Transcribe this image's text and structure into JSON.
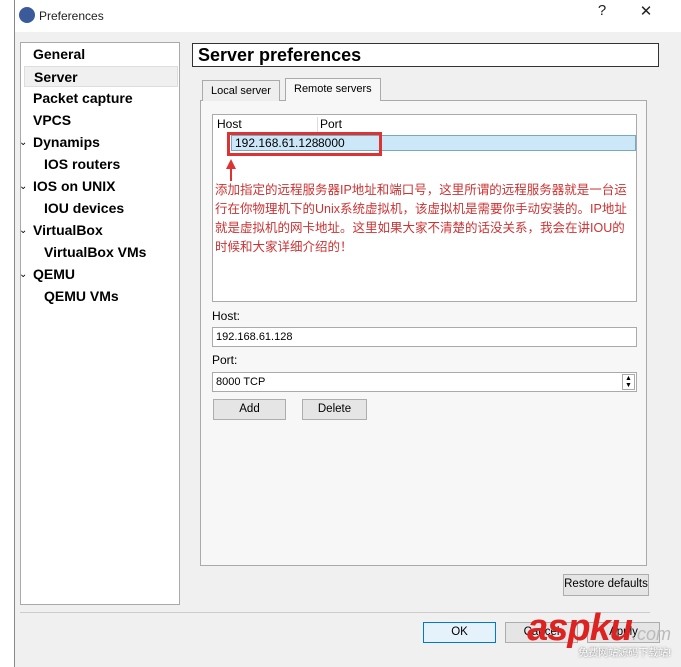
{
  "window": {
    "title": "Preferences",
    "help": "?",
    "close": "✕"
  },
  "sidebar": {
    "items": [
      {
        "label": "General",
        "level": 0
      },
      {
        "label": "Server",
        "level": 0,
        "selected": true
      },
      {
        "label": "Packet capture",
        "level": 0
      },
      {
        "label": "VPCS",
        "level": 0
      },
      {
        "label": "Dynamips",
        "level": 0,
        "expanded": true
      },
      {
        "label": "IOS routers",
        "level": 1
      },
      {
        "label": "IOS on UNIX",
        "level": 0,
        "expanded": true
      },
      {
        "label": "IOU devices",
        "level": 1
      },
      {
        "label": "VirtualBox",
        "level": 0,
        "expanded": true
      },
      {
        "label": "VirtualBox VMs",
        "level": 1
      },
      {
        "label": "QEMU",
        "level": 0,
        "expanded": true
      },
      {
        "label": "QEMU VMs",
        "level": 1
      }
    ]
  },
  "header": {
    "title": "Server preferences"
  },
  "tabs": [
    {
      "label": "Local server"
    },
    {
      "label": "Remote servers",
      "active": true
    }
  ],
  "servers": {
    "columns": [
      "Host",
      "Port"
    ],
    "rows": [
      {
        "host": "192.168.61.128",
        "port": "8000"
      }
    ]
  },
  "annotation": "添加指定的远程服务器IP地址和端口号，这里所谓的远程服务器就是一台运行在你物理机下的Unix系统虚拟机，该虚拟机是需要你手动安装的。IP地址就是虚拟机的网卡地址。这里如果大家不清楚的话没关系，我会在讲IOU的时候和大家详细介绍的！",
  "form": {
    "host_label": "Host:",
    "host_value": "192.168.61.128",
    "port_label": "Port:",
    "port_value": "8000 TCP",
    "add": "Add",
    "delete": "Delete"
  },
  "restore": "Restore defaults",
  "footer": {
    "ok": "OK",
    "cancel": "Cancel",
    "apply": "Apply"
  },
  "watermark": {
    "brand": "aspku",
    "suffix": ".com",
    "tagline": "免费网站源码下载站!"
  },
  "colors": {
    "annotation": "#cc3333",
    "selection": "#cce8f8"
  }
}
